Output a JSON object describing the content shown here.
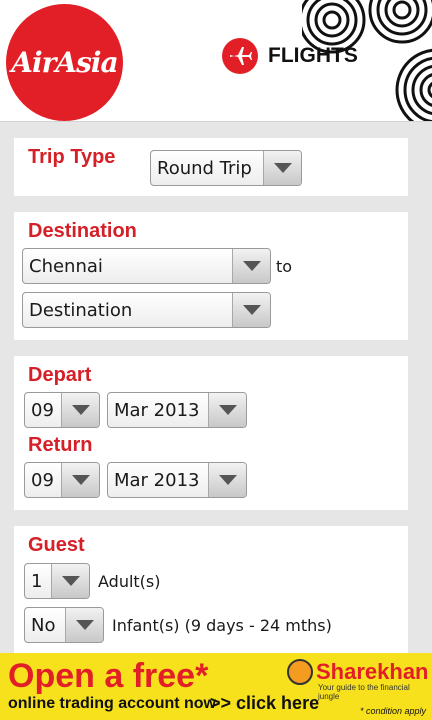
{
  "header": {
    "logo_text": "AirAsia",
    "section_icon": "plane-icon",
    "section_label": "FLIGHTS"
  },
  "trip_type": {
    "title": "Trip Type",
    "selected": "Round Trip"
  },
  "destination": {
    "title": "Destination",
    "from_value": "Chennai",
    "to_label": "to",
    "to_value": "Destination"
  },
  "dates": {
    "depart_title": "Depart",
    "depart_day": "09",
    "depart_month": "Mar 2013",
    "return_title": "Return",
    "return_day": "09",
    "return_month": "Mar 2013"
  },
  "guest": {
    "title": "Guest",
    "adults_value": "1",
    "adults_label": "Adult(s)",
    "infants_value": "No",
    "infants_label": "Infant(s) (9 days - 24 mths)"
  },
  "ad": {
    "headline": "Open a free*",
    "subline": "online trading account now",
    "cta": ">> click here",
    "brand": "Sharekhan",
    "tagline": "Your guide to the financial jungle",
    "note": "* condition apply"
  },
  "colors": {
    "brand_red": "#e21f26",
    "title_red": "#d52027",
    "ad_yellow": "#f7e11d"
  }
}
